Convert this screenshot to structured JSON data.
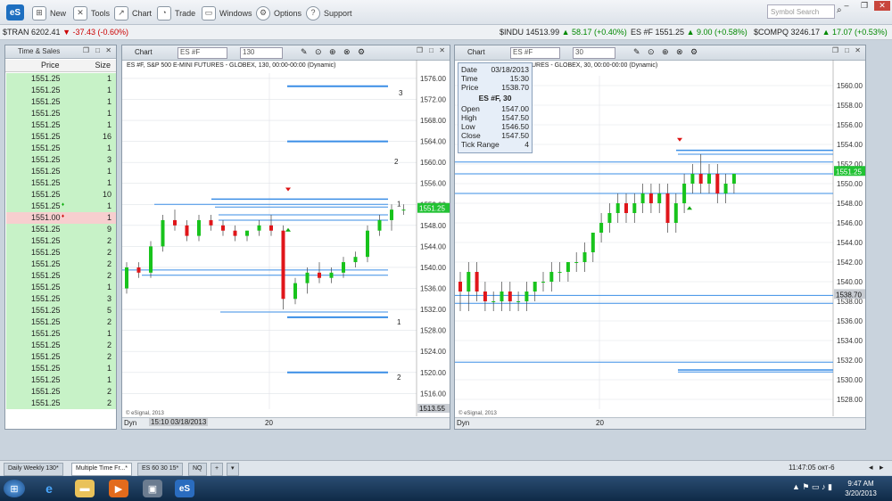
{
  "toolbar": {
    "logo": "eS",
    "items": [
      {
        "label": "New",
        "icon": "new-icon"
      },
      {
        "label": "Tools",
        "icon": "tools-icon"
      },
      {
        "label": "Chart",
        "icon": "chart-icon"
      },
      {
        "label": "Trade",
        "icon": "trade-icon"
      },
      {
        "label": "Windows",
        "icon": "windows-icon"
      },
      {
        "label": "Options",
        "icon": "gear-icon"
      },
      {
        "label": "Support",
        "icon": "help-icon"
      }
    ],
    "symbol_search_placeholder": "Symbol Search"
  },
  "ticker": [
    {
      "symbol": "$TRAN",
      "price": "6202.41",
      "change": "▼ -37.43 (-0.60%)",
      "dir": "neg"
    },
    {
      "symbol": "$INDU",
      "price": "14513.99",
      "change": "▲ 58.17 (+0.40%)",
      "dir": "pos"
    },
    {
      "symbol": "ES #F",
      "price": "1551.25",
      "change": "▲ 9.00 (+0.58%)",
      "dir": "pos"
    },
    {
      "symbol": "$COMPQ",
      "price": "3246.17",
      "change": "▲ 17.07 (+0.53%)",
      "dir": "pos"
    }
  ],
  "time_sales": {
    "title": "Time & Sales",
    "col_price": "Price",
    "col_size": "Size",
    "rows": [
      {
        "price": "1551.25",
        "size": "1"
      },
      {
        "price": "1551.25",
        "size": "1"
      },
      {
        "price": "1551.25",
        "size": "1"
      },
      {
        "price": "1551.25",
        "size": "1"
      },
      {
        "price": "1551.25",
        "size": "1"
      },
      {
        "price": "1551.25",
        "size": "16"
      },
      {
        "price": "1551.25",
        "size": "1"
      },
      {
        "price": "1551.25",
        "size": "3"
      },
      {
        "price": "1551.25",
        "size": "1"
      },
      {
        "price": "1551.25",
        "size": "1"
      },
      {
        "price": "1551.25",
        "size": "10"
      },
      {
        "price": "1551.25",
        "size": "1",
        "mark": "up"
      },
      {
        "price": "1551.00",
        "size": "1",
        "mark": "down"
      },
      {
        "price": "1551.25",
        "size": "9"
      },
      {
        "price": "1551.25",
        "size": "2"
      },
      {
        "price": "1551.25",
        "size": "2"
      },
      {
        "price": "1551.25",
        "size": "2"
      },
      {
        "price": "1551.25",
        "size": "2"
      },
      {
        "price": "1551.25",
        "size": "1"
      },
      {
        "price": "1551.25",
        "size": "3"
      },
      {
        "price": "1551.25",
        "size": "5"
      },
      {
        "price": "1551.25",
        "size": "2"
      },
      {
        "price": "1551.25",
        "size": "1"
      },
      {
        "price": "1551.25",
        "size": "2"
      },
      {
        "price": "1551.25",
        "size": "2"
      },
      {
        "price": "1551.25",
        "size": "1"
      },
      {
        "price": "1551.25",
        "size": "1"
      },
      {
        "price": "1551.25",
        "size": "2"
      },
      {
        "price": "1551.25",
        "size": "2"
      }
    ]
  },
  "chart1": {
    "tab": "Chart",
    "symbol": "ES #F",
    "interval": "130",
    "title": "ES #F, S&P 500 E-MINI FUTURES - GLOBEX, 130, 00:00-00:00 (Dynamic)",
    "copyright": "© eSignal, 2013",
    "price_badge": "1551.25",
    "low_badge": "1513.55",
    "bottom_left": "Dyn",
    "date_label": "15:10 03/18/2013",
    "x_label": "20"
  },
  "chart2": {
    "tab": "Chart",
    "symbol": "ES #F",
    "interval": "30",
    "title": "URES - GLOBEX, 30, 00:00-00:00 (Dynamic)",
    "copyright": "© eSignal, 2013",
    "price_badge": "1551.25",
    "cursor_badge": "1538.70",
    "bottom_left": "Dyn",
    "x_label": "20",
    "info": {
      "date_k": "Date",
      "date_v": "03/18/2013",
      "time_k": "Time",
      "time_v": "15:30",
      "price_k": "Price",
      "price_v": "1538.70",
      "heading": "ES #F, 30",
      "open_k": "Open",
      "open_v": "1547.00",
      "high_k": "High",
      "high_v": "1547.50",
      "low_k": "Low",
      "low_v": "1546.50",
      "close_k": "Close",
      "close_v": "1547.50",
      "tick_k": "Tick Range",
      "tick_v": "4"
    }
  },
  "tabs": [
    "Daily Weekly 130*",
    "Multiple Time Fr...*",
    "ES 60 30 15*",
    "NQ"
  ],
  "status_time": "11:47:05 окт-6",
  "clock": {
    "time": "9:47 AM",
    "date": "3/20/2013"
  }
}
